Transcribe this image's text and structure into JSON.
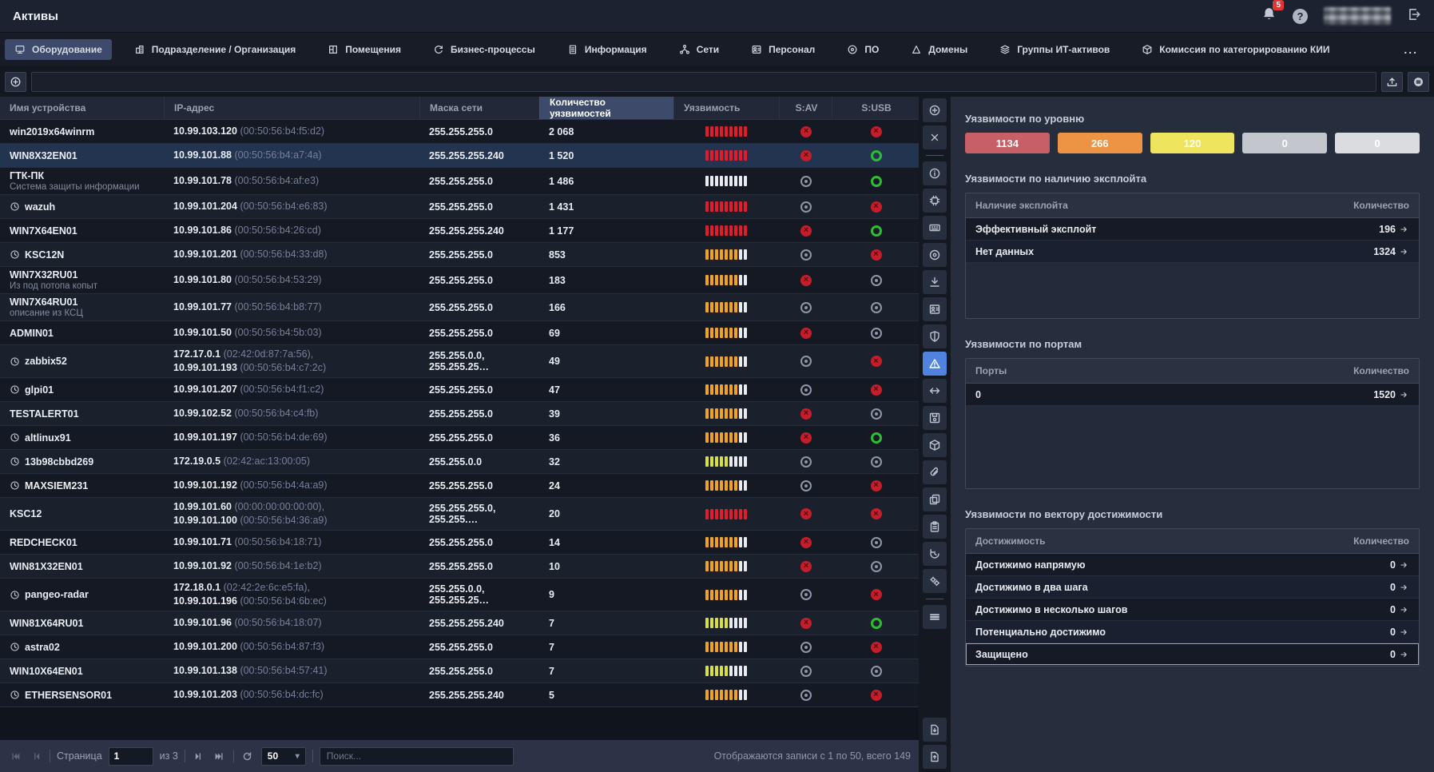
{
  "header": {
    "title": "Активы",
    "notifications_count": "5"
  },
  "tabs_more": "...",
  "tabs": [
    {
      "id": "equipment",
      "label": "Оборудование",
      "icon": "equipment",
      "active": true
    },
    {
      "id": "orgunit",
      "label": "Подразделение / Организация",
      "icon": "building"
    },
    {
      "id": "rooms",
      "label": "Помещения",
      "icon": "rooms"
    },
    {
      "id": "processes",
      "label": "Бизнес-процессы",
      "icon": "process"
    },
    {
      "id": "information",
      "label": "Информация",
      "icon": "document"
    },
    {
      "id": "networks",
      "label": "Сети",
      "icon": "network"
    },
    {
      "id": "personnel",
      "label": "Персонал",
      "icon": "person-card"
    },
    {
      "id": "software",
      "label": "ПО",
      "icon": "disc"
    },
    {
      "id": "domains",
      "label": "Домены",
      "icon": "triangle"
    },
    {
      "id": "asset-groups",
      "label": "Группы ИТ-активов",
      "icon": "layers"
    },
    {
      "id": "kii",
      "label": "Комиссия по категорированию КИИ",
      "icon": "cube"
    }
  ],
  "table": {
    "columns": [
      {
        "id": "name",
        "label": "Имя устройства"
      },
      {
        "id": "ip",
        "label": "IP-адрес"
      },
      {
        "id": "mask",
        "label": "Маска сети"
      },
      {
        "id": "count",
        "label": "Количество уязвимостей",
        "sorted": true
      },
      {
        "id": "vuln",
        "label": "Уязвимость"
      },
      {
        "id": "av",
        "label": "S:AV"
      },
      {
        "id": "usb",
        "label": "S:USB"
      }
    ],
    "rows": [
      {
        "name": "win2019x64winrm",
        "clock": false,
        "ips": [
          {
            "ip": "10.99.103.120",
            "mac": "(00:50:56:b4:f5:d2)"
          }
        ],
        "mask": "255.255.255.0",
        "count": "2 068",
        "sev": "red",
        "av": "red",
        "usb": "red"
      },
      {
        "name": "WIN8X32EN01",
        "selected": true,
        "clock": false,
        "ips": [
          {
            "ip": "10.99.101.88",
            "mac": "(00:50:56:b4:a7:4a)"
          }
        ],
        "mask": "255.255.255.240",
        "count": "1 520",
        "sev": "red",
        "av": "red",
        "usb": "green"
      },
      {
        "name": "ГТК-ПК",
        "desc": "Система защиты информации",
        "clock": false,
        "ips": [
          {
            "ip": "10.99.101.78",
            "mac": "(00:50:56:b4:af:e3)"
          }
        ],
        "mask": "255.255.255.0",
        "count": "1 486",
        "sev": "none",
        "av": "gray",
        "usb": "green"
      },
      {
        "name": "wazuh",
        "clock": true,
        "ips": [
          {
            "ip": "10.99.101.204",
            "mac": "(00:50:56:b4:e6:83)"
          }
        ],
        "mask": "255.255.255.0",
        "count": "1 431",
        "sev": "red",
        "av": "gray",
        "usb": "red"
      },
      {
        "name": "WIN7X64EN01",
        "clock": false,
        "ips": [
          {
            "ip": "10.99.101.86",
            "mac": "(00:50:56:b4:26:cd)"
          }
        ],
        "mask": "255.255.255.240",
        "count": "1 177",
        "sev": "red",
        "av": "red",
        "usb": "green"
      },
      {
        "name": "KSC12N",
        "clock": true,
        "ips": [
          {
            "ip": "10.99.101.201",
            "mac": "(00:50:56:b4:33:d8)"
          }
        ],
        "mask": "255.255.255.0",
        "count": "853",
        "sev": "orange",
        "av": "gray",
        "usb": "red"
      },
      {
        "name": "WIN7X32RU01",
        "desc": "Из под потопа копыт",
        "clock": false,
        "ips": [
          {
            "ip": "10.99.101.80",
            "mac": "(00:50:56:b4:53:29)"
          }
        ],
        "mask": "255.255.255.0",
        "count": "183",
        "sev": "orange",
        "av": "red",
        "usb": "gray"
      },
      {
        "name": "WIN7X64RU01",
        "desc": "описание из КСЦ",
        "clock": false,
        "ips": [
          {
            "ip": "10.99.101.77",
            "mac": "(00:50:56:b4:b8:77)"
          }
        ],
        "mask": "255.255.255.0",
        "count": "166",
        "sev": "orange",
        "av": "gray",
        "usb": "gray"
      },
      {
        "name": "ADMIN01",
        "clock": false,
        "ips": [
          {
            "ip": "10.99.101.50",
            "mac": "(00:50:56:b4:5b:03)"
          }
        ],
        "mask": "255.255.255.0",
        "count": "69",
        "sev": "orange",
        "av": "red",
        "usb": "gray"
      },
      {
        "name": "zabbix52",
        "clock": true,
        "ips": [
          {
            "ip": "172.17.0.1",
            "mac": "(02:42:0d:87:7a:56),"
          },
          {
            "ip": "10.99.101.193",
            "mac": "(00:50:56:b4:c7:2c)"
          }
        ],
        "mask": "255.255.0.0, 255.255.25…",
        "count": "49",
        "sev": "orange",
        "av": "gray",
        "usb": "red"
      },
      {
        "name": "glpi01",
        "clock": true,
        "ips": [
          {
            "ip": "10.99.101.207",
            "mac": "(00:50:56:b4:f1:c2)"
          }
        ],
        "mask": "255.255.255.0",
        "count": "47",
        "sev": "orange",
        "av": "gray",
        "usb": "red"
      },
      {
        "name": "TESTALERT01",
        "clock": false,
        "ips": [
          {
            "ip": "10.99.102.52",
            "mac": "(00:50:56:b4:c4:fb)"
          }
        ],
        "mask": "255.255.255.0",
        "count": "39",
        "sev": "orange",
        "av": "red",
        "usb": "gray"
      },
      {
        "name": "altlinux91",
        "clock": true,
        "ips": [
          {
            "ip": "10.99.101.197",
            "mac": "(00:50:56:b4:de:69)"
          }
        ],
        "mask": "255.255.255.0",
        "count": "36",
        "sev": "orange",
        "av": "red",
        "usb": "green"
      },
      {
        "name": "13b98cbbd269",
        "clock": true,
        "ips": [
          {
            "ip": "172.19.0.5",
            "mac": "(02:42:ac:13:00:05)"
          }
        ],
        "mask": "255.255.0.0",
        "count": "32",
        "sev": "yellow",
        "av": "gray",
        "usb": "gray"
      },
      {
        "name": "MAXSIEM231",
        "clock": true,
        "ips": [
          {
            "ip": "10.99.101.192",
            "mac": "(00:50:56:b4:4a:a9)"
          }
        ],
        "mask": "255.255.255.0",
        "count": "24",
        "sev": "orange",
        "av": "gray",
        "usb": "red"
      },
      {
        "name": "KSC12",
        "clock": false,
        "ips": [
          {
            "ip": "10.99.101.60",
            "mac": "(00:00:00:00:00:00),"
          },
          {
            "ip": "10.99.101.100",
            "mac": "(00:50:56:b4:36:a9)"
          }
        ],
        "mask": "255.255.255.0, 255.255.…",
        "count": "20",
        "sev": "red",
        "av": "red",
        "usb": "red"
      },
      {
        "name": "REDCHECK01",
        "clock": false,
        "ips": [
          {
            "ip": "10.99.101.71",
            "mac": "(00:50:56:b4:18:71)"
          }
        ],
        "mask": "255.255.255.0",
        "count": "14",
        "sev": "orange",
        "av": "red",
        "usb": "gray"
      },
      {
        "name": "WIN81X32EN01",
        "clock": false,
        "ips": [
          {
            "ip": "10.99.101.92",
            "mac": "(00:50:56:b4:1e:b2)"
          }
        ],
        "mask": "255.255.255.0",
        "count": "10",
        "sev": "orange",
        "av": "red",
        "usb": "gray"
      },
      {
        "name": "pangeo-radar",
        "clock": true,
        "ips": [
          {
            "ip": "172.18.0.1",
            "mac": "(02:42:2e:6c:e5:fa),"
          },
          {
            "ip": "10.99.101.196",
            "mac": "(00:50:56:b4:6b:ec)"
          }
        ],
        "mask": "255.255.0.0, 255.255.25…",
        "count": "9",
        "sev": "orange",
        "av": "gray",
        "usb": "red"
      },
      {
        "name": "WIN81X64RU01",
        "clock": false,
        "ips": [
          {
            "ip": "10.99.101.96",
            "mac": "(00:50:56:b4:18:07)"
          }
        ],
        "mask": "255.255.255.240",
        "count": "7",
        "sev": "yellow",
        "av": "red",
        "usb": "green"
      },
      {
        "name": "astra02",
        "clock": true,
        "ips": [
          {
            "ip": "10.99.101.200",
            "mac": "(00:50:56:b4:87:f3)"
          }
        ],
        "mask": "255.255.255.0",
        "count": "7",
        "sev": "orange",
        "av": "gray",
        "usb": "red"
      },
      {
        "name": "WIN10X64EN01",
        "clock": false,
        "ips": [
          {
            "ip": "10.99.101.138",
            "mac": "(00:50:56:b4:57:41)"
          }
        ],
        "mask": "255.255.255.0",
        "count": "7",
        "sev": "yellow",
        "av": "gray",
        "usb": "gray"
      },
      {
        "name": "ETHERSENSOR01",
        "clock": true,
        "ips": [
          {
            "ip": "10.99.101.203",
            "mac": "(00:50:56:b4:dc:fc)"
          }
        ],
        "mask": "255.255.255.240",
        "count": "5",
        "sev": "orange",
        "av": "gray",
        "usb": "red"
      }
    ]
  },
  "toolbar": {
    "items": [
      {
        "name": "add",
        "icon": "add"
      },
      {
        "name": "close",
        "icon": "close"
      },
      {
        "type": "divider"
      },
      {
        "name": "info",
        "icon": "info"
      },
      {
        "name": "hardware",
        "icon": "chip"
      },
      {
        "name": "system",
        "icon": "keyboard"
      },
      {
        "name": "software",
        "icon": "disc"
      },
      {
        "name": "downloads",
        "icon": "download"
      },
      {
        "name": "personal-card",
        "icon": "person-card"
      },
      {
        "name": "security",
        "icon": "shield"
      },
      {
        "name": "vulnerabilities",
        "icon": "warning",
        "active": true
      },
      {
        "name": "connections",
        "icon": "arrows-lr"
      },
      {
        "name": "storage",
        "icon": "floppy"
      },
      {
        "name": "components",
        "icon": "cube"
      },
      {
        "name": "attachments",
        "icon": "paperclip"
      },
      {
        "name": "copy",
        "icon": "copy"
      },
      {
        "name": "tasks",
        "icon": "clipboard"
      },
      {
        "name": "history",
        "icon": "history"
      },
      {
        "name": "settings",
        "icon": "gears"
      },
      {
        "type": "divider"
      },
      {
        "name": "details",
        "icon": "menu"
      },
      {
        "type": "spacer"
      },
      {
        "name": "export-document",
        "icon": "doc-down"
      },
      {
        "name": "import-document",
        "icon": "doc-up"
      }
    ]
  },
  "sidebar": {
    "level": {
      "title": "Уязвимости по уровню",
      "badges": [
        {
          "name": "critical",
          "value": "1134",
          "color": "#c75f66"
        },
        {
          "name": "high",
          "value": "266",
          "color": "#ec9344"
        },
        {
          "name": "medium",
          "value": "120",
          "color": "#efe45d"
        },
        {
          "name": "low",
          "value": "0",
          "color": "#c3c7cd"
        },
        {
          "name": "info",
          "value": "0",
          "color": "#dadce0"
        }
      ]
    },
    "exploit": {
      "title": "Уязвимости по наличию эксплойта",
      "col1": "Наличие эксплойта",
      "col2": "Количество",
      "rows": [
        {
          "label": "Эффективный эксплойт",
          "value": "196"
        },
        {
          "label": "Нет данных",
          "value": "1324"
        }
      ]
    },
    "ports": {
      "title": "Уязвимости по портам",
      "col1": "Порты",
      "col2": "Количество",
      "rows": [
        {
          "label": "0",
          "value": "1520"
        }
      ]
    },
    "reach": {
      "title": "Уязвимости по вектору достижимости",
      "col1": "Достижимость",
      "col2": "Количество",
      "rows": [
        {
          "label": "Достижимо напрямую",
          "value": "0"
        },
        {
          "label": "Достижимо в два шага",
          "value": "0"
        },
        {
          "label": "Достижимо в несколько шагов",
          "value": "0"
        },
        {
          "label": "Потенциально достижимо",
          "value": "0"
        },
        {
          "label": "Защищено",
          "value": "0",
          "focused": true
        }
      ]
    }
  },
  "pagination": {
    "page_label": "Страница",
    "page_value": "1",
    "of_label": "из 3",
    "page_size": "50",
    "search_placeholder": "Поиск...",
    "summary": "Отображаются записи с 1 по 50, всего 149"
  }
}
